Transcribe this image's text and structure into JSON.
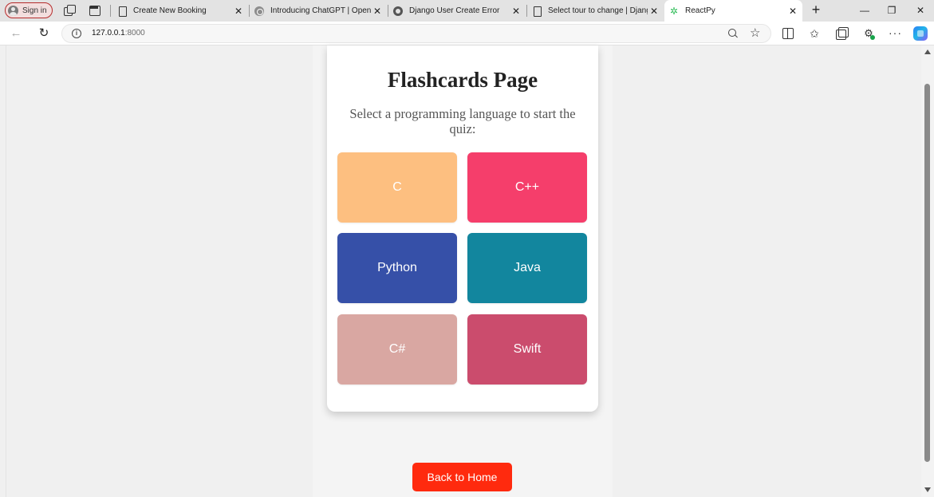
{
  "browser": {
    "sign_in_label": "Sign in",
    "tabs": [
      {
        "title": "Create New Booking",
        "favicon": "page-icon",
        "active": false
      },
      {
        "title": "Introducing ChatGPT | OpenAI",
        "favicon": "openai-icon",
        "active": false
      },
      {
        "title": "Django User Create Error",
        "favicon": "django-icon",
        "active": false
      },
      {
        "title": "Select tour to change | Django",
        "favicon": "page-icon",
        "active": false
      },
      {
        "title": "ReactPy",
        "favicon": "react-icon",
        "active": true
      }
    ],
    "new_tab_label": "+",
    "address": {
      "host": "127.0.0.1",
      "port": ":8000"
    }
  },
  "page": {
    "title": "Flashcards Page",
    "subtitle": "Select a programming language to start the quiz:",
    "languages": [
      {
        "label": "C",
        "color": "#fdbf80"
      },
      {
        "label": "C++",
        "color": "#f53e6b"
      },
      {
        "label": "Python",
        "color": "#3650a8"
      },
      {
        "label": "Java",
        "color": "#12869e"
      },
      {
        "label": "C#",
        "color": "#d9a7a2"
      },
      {
        "label": "Swift",
        "color": "#cb4c6d"
      }
    ],
    "back_button": "Back to Home",
    "back_button_color": "#ff2a0e"
  }
}
